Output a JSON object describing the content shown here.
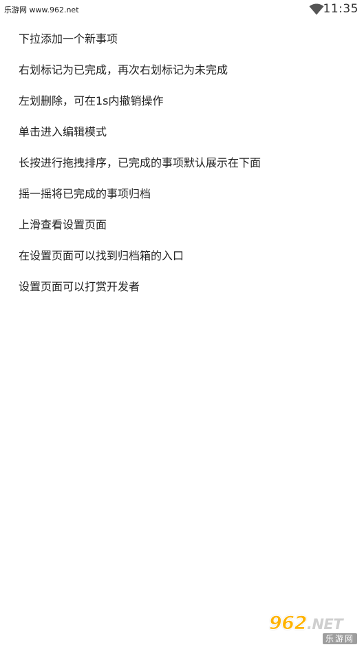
{
  "status_bar": {
    "watermark": "乐游网 www.962.net",
    "time": "11:35",
    "wifi_icon": "wifi-icon"
  },
  "tips": [
    {
      "label": "下拉添加一个新事项"
    },
    {
      "label": "右划标记为已完成，再次右划标记为未完成"
    },
    {
      "label": "左划删除，可在1s内撤销操作"
    },
    {
      "label": "单击进入编辑模式"
    },
    {
      "label": "长按进行拖拽排序，已完成的事项默认展示在下面"
    },
    {
      "label": "摇一摇将已完成的事项归档"
    },
    {
      "label": "上滑查看设置页面"
    },
    {
      "label": "在设置页面可以找到归档箱的入口"
    },
    {
      "label": "设置页面可以打赏开发者"
    }
  ],
  "watermark_logo": {
    "numbers": "962",
    "suffix": ".NET",
    "sub": "乐游网"
  },
  "colors": {
    "text": "#212121",
    "background": "#ffffff",
    "logo_accent": "#ffb300"
  }
}
